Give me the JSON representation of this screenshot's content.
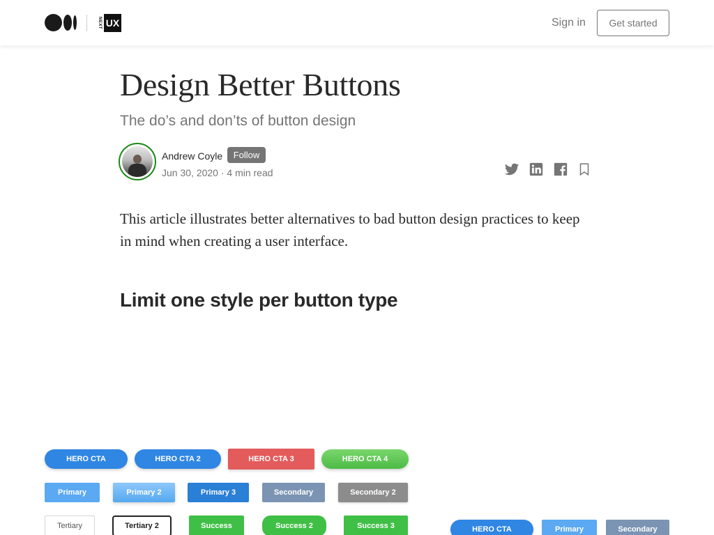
{
  "nav": {
    "publication_logo_small": "NEXT",
    "publication_logo_big": "UX",
    "sign_in": "Sign in",
    "get_started": "Get started"
  },
  "article": {
    "title": "Design Better Buttons",
    "subtitle": "The do’s and don’ts of button design",
    "author": "Andrew Coyle",
    "follow": "Follow",
    "meta": "Jun 30, 2020 · 4 min read",
    "intro": "This article illustrates better alternatives to bad button design practices to keep in mind when creating a user interface.",
    "section_heading": "Limit one style per button type"
  },
  "share_icons": [
    "twitter-icon",
    "linkedin-icon",
    "facebook-icon",
    "bookmark-icon"
  ],
  "figure": {
    "hero_row": [
      "HERO CTA",
      "HERO CTA 2",
      "HERO CTA 3",
      "HERO CTA 4"
    ],
    "primary_row": [
      "Primary",
      "Primary 2",
      "Primary 3",
      "Secondary",
      "Secondary 2"
    ],
    "tertiary_row": [
      "Tertiary",
      "Tertiary 2",
      "Success",
      "Success 2",
      "Success 3"
    ],
    "good_row": [
      "HERO CTA",
      "Primary",
      "Secondary"
    ]
  },
  "colors": {
    "text": "#292929",
    "muted": "#757575",
    "hero_blue": "#2f86e3",
    "hero_red": "#e35b5b",
    "success_green": "#3fbf45",
    "secondary_slate": "#7b94b3",
    "avatar_ring": "#1a8917"
  }
}
